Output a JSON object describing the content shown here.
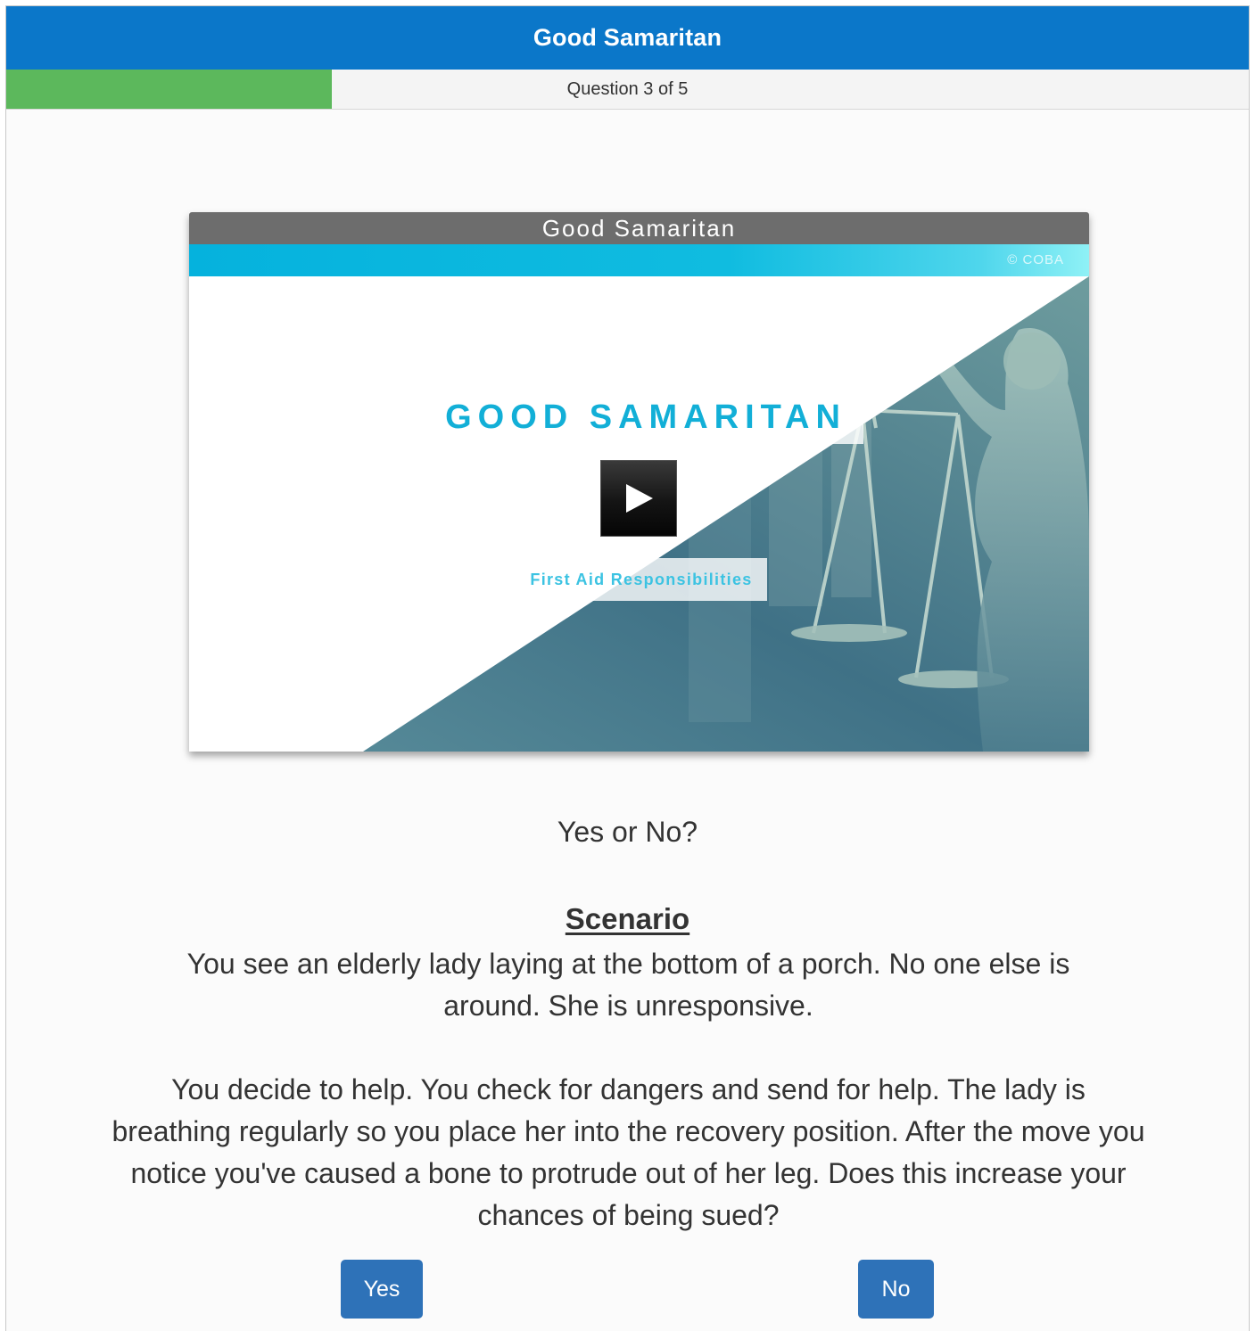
{
  "header": {
    "title": "Good Samaritan"
  },
  "progress": {
    "label": "Question 3 of 5",
    "current": 3,
    "total": 5,
    "fill_fraction": 0.262
  },
  "video": {
    "header_title": "Good Samaritan",
    "copyright": "© COBA",
    "title": "GOOD SAMARITAN",
    "subtitle": "First Aid Responsibilities",
    "play_icon": "play-icon",
    "colors": {
      "header": "#6d6d6d",
      "banner": "#05b2dd",
      "title": "#12afd7"
    }
  },
  "question": {
    "type_label": "Yes or No?",
    "scenario_heading": "Scenario",
    "scenario_text": "You see an elderly lady laying at the bottom of a porch. No one else is around. She is unresponsive.",
    "question_text": "You decide to help. You check for dangers and send for help. The lady is breathing regularly so you place her into the recovery position. After the move you notice you've caused a bone to protrude out of her leg. Does this increase your chances of being sued?"
  },
  "answers": {
    "yes_label": "Yes",
    "no_label": "No"
  },
  "colors": {
    "header_bar": "#0b77c9",
    "progress_fill": "#5cb85c",
    "button": "#2e72b8"
  }
}
